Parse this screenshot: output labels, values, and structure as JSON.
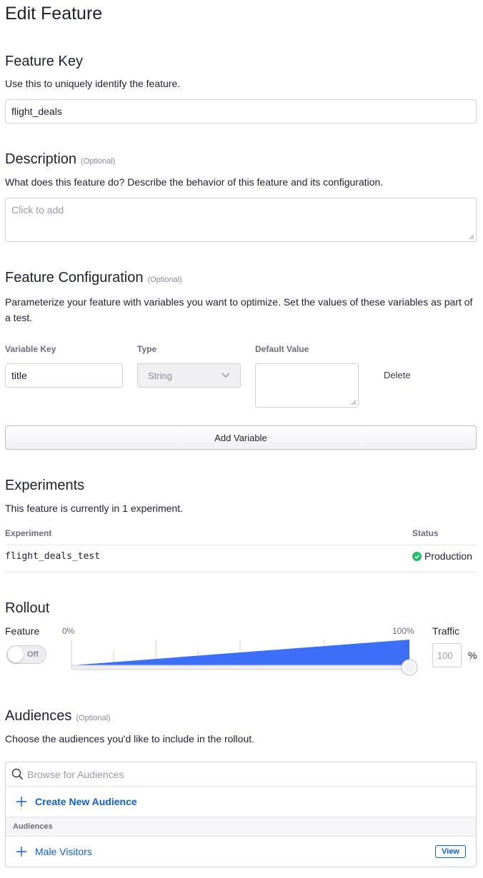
{
  "page": {
    "title": "Edit Feature"
  },
  "feature_key": {
    "heading": "Feature Key",
    "description": "Use this to uniquely identify the feature.",
    "value": "flight_deals"
  },
  "description": {
    "heading": "Description",
    "optional": "(Optional)",
    "help": "What does this feature do? Describe the behavior of this feature and its configuration.",
    "placeholder": "Click to add"
  },
  "configuration": {
    "heading": "Feature Configuration",
    "optional": "(Optional)",
    "help": "Parameterize your feature with variables you want to optimize. Set the values of these variables as part of a test.",
    "col_key": "Variable Key",
    "col_type": "Type",
    "col_default": "Default Value",
    "variable": {
      "key": "title",
      "type": "String",
      "default": ""
    },
    "delete_label": "Delete",
    "add_label": "Add Variable"
  },
  "experiments": {
    "heading": "Experiments",
    "summary": "This feature is currently in 1 experiment.",
    "col_experiment": "Experiment",
    "col_status": "Status",
    "rows": [
      {
        "name": "flight_deals_test",
        "status": "Production"
      }
    ]
  },
  "rollout": {
    "heading": "Rollout",
    "feature_label": "Feature",
    "toggle_label": "Off",
    "min_label": "0%",
    "max_label": "100%",
    "traffic_label": "Traffic",
    "traffic_value": "100",
    "traffic_unit": "%",
    "slider_fraction": 1.0,
    "accent": "#3d6ef7"
  },
  "audiences": {
    "heading": "Audiences",
    "optional": "(Optional)",
    "help": "Choose the audiences you'd like to include in the rollout.",
    "search_placeholder": "Browse for Audiences",
    "create_label": "Create New Audience",
    "group_label": "Audiences",
    "items": [
      {
        "label": "Male Visitors",
        "view_label": "View"
      }
    ]
  }
}
